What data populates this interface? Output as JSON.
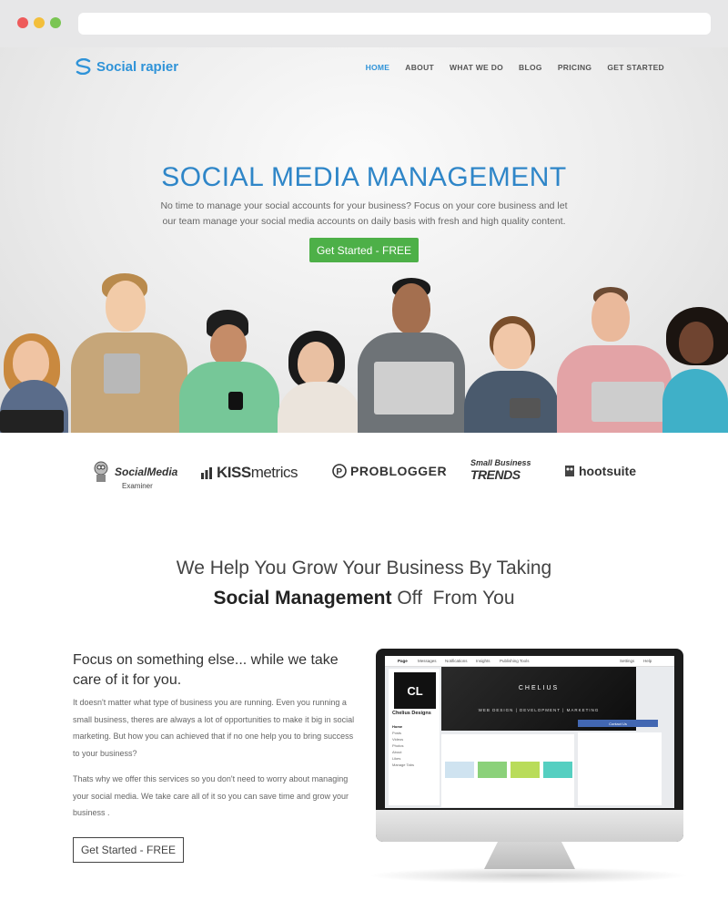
{
  "brand": {
    "name": "Social rapier"
  },
  "nav": {
    "items": [
      "HOME",
      "ABOUT",
      "WHAT WE DO",
      "BLOG",
      "PRICING",
      "GET STARTED"
    ],
    "active": "HOME"
  },
  "hero": {
    "title": "SOCIAL MEDIA MANAGEMENT",
    "subtitle": "No time to manage your social accounts for your business? Focus on your core business and let our team manage your social media accounts on daily basis with fresh and high quality content.",
    "cta": "Get Started - FREE"
  },
  "brands": {
    "sme_main": "SocialMedia",
    "sme_sub": "Examiner",
    "kiss_bold": "KISS",
    "kiss_light": "metrics",
    "problogger": "PROBLOGGER",
    "sbt_top": "Small Business",
    "sbt_bottom": "TRENDS",
    "hootsuite": "hootsuite"
  },
  "section": {
    "line1": "We Help You Grow Your Business By Taking",
    "line2_bold": "Social Management",
    "line2_rest": " Off  From You"
  },
  "focus": {
    "title": "Focus on something else... while we take care of it for you.",
    "p1": "It doesn't matter what type of business you are running. Even you running a small business, theres are always a lot of opportunities to make it big in social marketing. But how you can achieved that if no one help you to bring success to your business?",
    "p2": "Thats why we offer this services so you don't need to worry about managing your social media. We take care all of it so you can save time and grow your business .",
    "cta": "Get Started - FREE"
  },
  "mockup": {
    "tabs": [
      "Page",
      "Messages",
      "Notifications",
      "Insights",
      "Publishing Tools"
    ],
    "right_tabs": [
      "Settings",
      "Help"
    ],
    "logo": "CL",
    "logo_sub": "DESIGNS",
    "page_name": "Chelius Designs",
    "menu": [
      "Home",
      "Posts",
      "Videos",
      "Photos",
      "About",
      "Likes",
      "Manage Tabs"
    ],
    "cover_title": "CHELIUS",
    "cover_sub": "WEB DESIGN  |  DEVELOPMENT  |  MARKETING",
    "contact": "Contact Us",
    "colors": {
      "fb_blue": "#4267b2"
    }
  },
  "colors": {
    "accent": "#2f93d8",
    "cta_green": "#4db048"
  }
}
